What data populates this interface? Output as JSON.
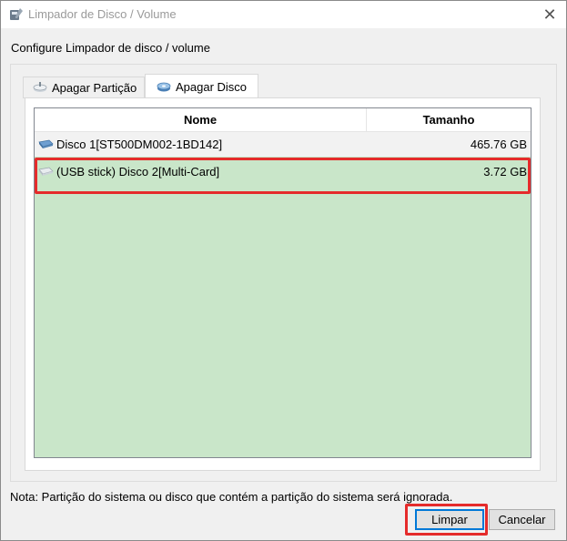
{
  "window": {
    "title": "Limpador de Disco / Volume",
    "close_symbol": "✕"
  },
  "heading": "Configure Limpador de disco / volume",
  "tabs": [
    {
      "label": "Apagar Partição",
      "icon": "partition-icon",
      "selected": false
    },
    {
      "label": "Apagar Disco",
      "icon": "disk-icon",
      "selected": true
    }
  ],
  "table": {
    "columns": [
      "Nome",
      "Tamanho"
    ],
    "rows": [
      {
        "name": "Disco 1[ST500DM002-1BD142]",
        "size": "465.76 GB",
        "icon": "hard-drive-icon"
      },
      {
        "name": "(USB stick) Disco 2[Multi-Card]",
        "size": "3.72 GB",
        "icon": "usb-drive-icon",
        "selected": true
      }
    ]
  },
  "note": "Nota: Partição do sistema ou disco que contém a partição do sistema será ignorada.",
  "buttons": {
    "primary": "Limpar",
    "cancel": "Cancelar"
  },
  "colors": {
    "list_background": "#c9e6c9",
    "highlight": "#e52b2b",
    "focus": "#0078d7"
  }
}
